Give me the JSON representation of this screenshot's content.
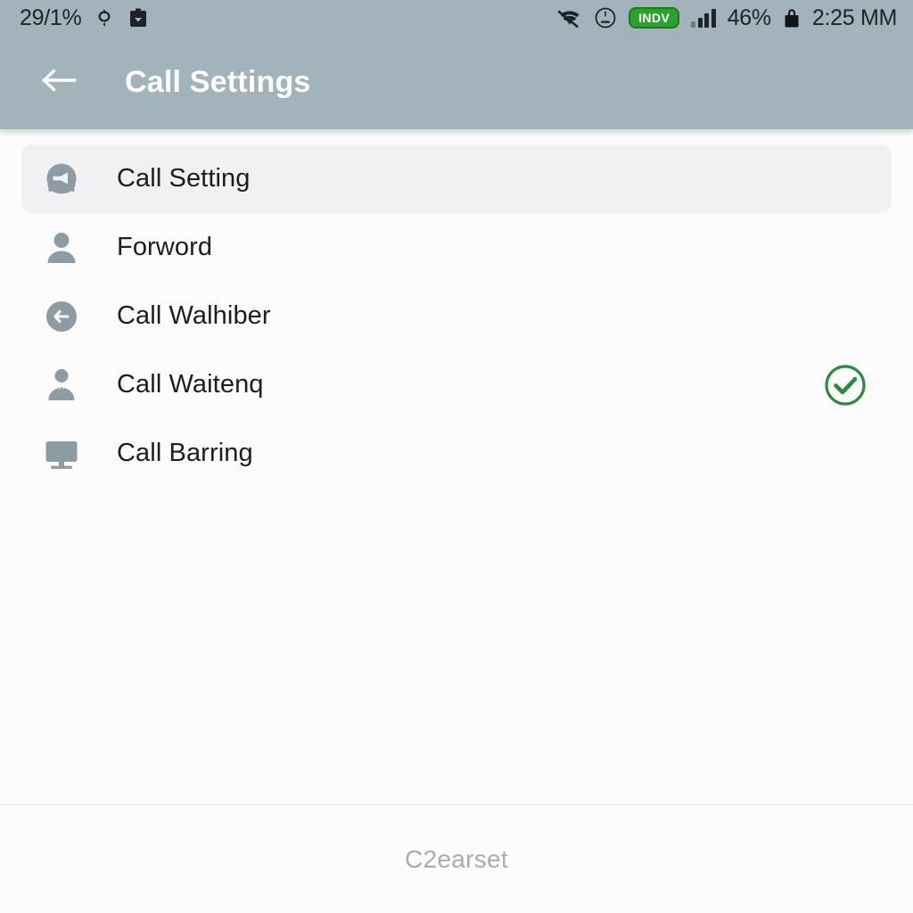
{
  "status_bar": {
    "battery_left_text": "29/1%",
    "left_icons": [
      {
        "name": "sync-rotate-icon"
      },
      {
        "name": "clipboard-download-icon"
      }
    ],
    "right_icons": [
      {
        "name": "wifi-off-icon"
      },
      {
        "name": "face-circle-icon"
      }
    ],
    "carrier_badge": "INDV",
    "signal_bars": 4,
    "battery_percent": "46%",
    "lock_icon": "lock-icon",
    "time": "2:25 MM"
  },
  "app_bar": {
    "back_icon": "arrow-left-icon",
    "title": "Call Settings"
  },
  "list": {
    "items": [
      {
        "label": "Call Setting",
        "icon": "megaphone-circle-icon",
        "selected": true,
        "checked": false
      },
      {
        "label": "Forword",
        "icon": "person-icon",
        "selected": false,
        "checked": false
      },
      {
        "label": "Call Walhiber",
        "icon": "arrow-left-circle-icon",
        "selected": false,
        "checked": false
      },
      {
        "label": "Call Waitenq",
        "icon": "person-suit-icon",
        "selected": false,
        "checked": true
      },
      {
        "label": "Call Barring",
        "icon": "monitor-icon",
        "selected": false,
        "checked": false
      }
    ]
  },
  "footer": {
    "label": "C2earset"
  },
  "colors": {
    "header_bg": "#a2b3bc",
    "body_bg": "#fcfcfc",
    "selected_row_bg": "#f0f1f2",
    "icon_gray": "#8d9ba4",
    "check_green": "#2e8b3d",
    "badge_green": "#2ca22c",
    "label_text": "#1d1d1f",
    "footer_text": "#a9acaf"
  }
}
